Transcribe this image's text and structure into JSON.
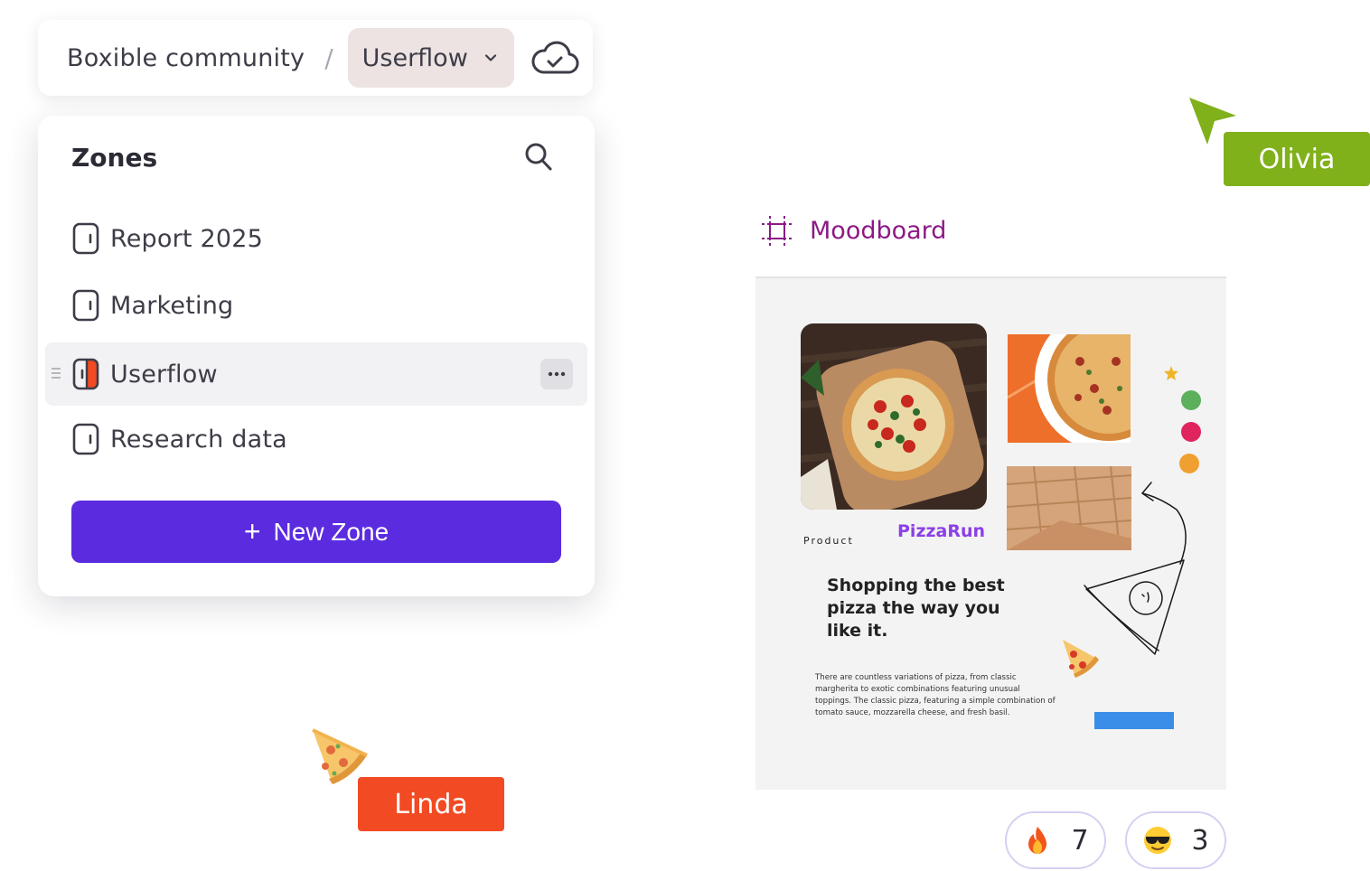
{
  "breadcrumb": {
    "root": "Boxible community",
    "separator": "/",
    "current": "Userflow",
    "sync_icon": "cloud-check-icon"
  },
  "zones_panel": {
    "title": "Zones",
    "search_icon": "search-icon",
    "items": [
      {
        "label": "Report 2025",
        "icon": "zone-icon",
        "active": false
      },
      {
        "label": "Marketing",
        "icon": "zone-icon",
        "active": false
      },
      {
        "label": "Userflow",
        "icon": "zone-icon",
        "active": true
      },
      {
        "label": "Research data",
        "icon": "zone-icon",
        "active": false
      }
    ],
    "new_zone_button": {
      "plus": "+",
      "label": "New Zone"
    }
  },
  "cursors": [
    {
      "name": "Olivia",
      "color": "#80b01a",
      "icon": "cursor-arrow-icon"
    },
    {
      "name": "Linda",
      "color": "#f24a22",
      "icon": "pizza-cursor-icon"
    }
  ],
  "moodboard": {
    "title": "Moodboard",
    "icon": "frame-icon",
    "product_label": "Product",
    "brand": "PizzaRun",
    "headline": "Shopping the best pizza the way you like it.",
    "body": "There are countless variations of pizza, from classic margherita to exotic combinations featuring unusual toppings. The classic pizza, featuring a simple combination of tomato sauce, mozzarella cheese, and fresh basil.",
    "swatches": [
      "#5cb05c",
      "#e0245e",
      "#f0a030"
    ],
    "accent_star": "#f0b429",
    "bar_color": "#3a8ee8"
  },
  "reactions": [
    {
      "emoji": "fire-emoji",
      "count": "7"
    },
    {
      "emoji": "sunglasses-emoji",
      "count": "3"
    }
  ],
  "colors": {
    "primary": "#5b2be0",
    "active_crumb_bg": "#ede3e3",
    "moodboard_title": "#8b1a86"
  }
}
